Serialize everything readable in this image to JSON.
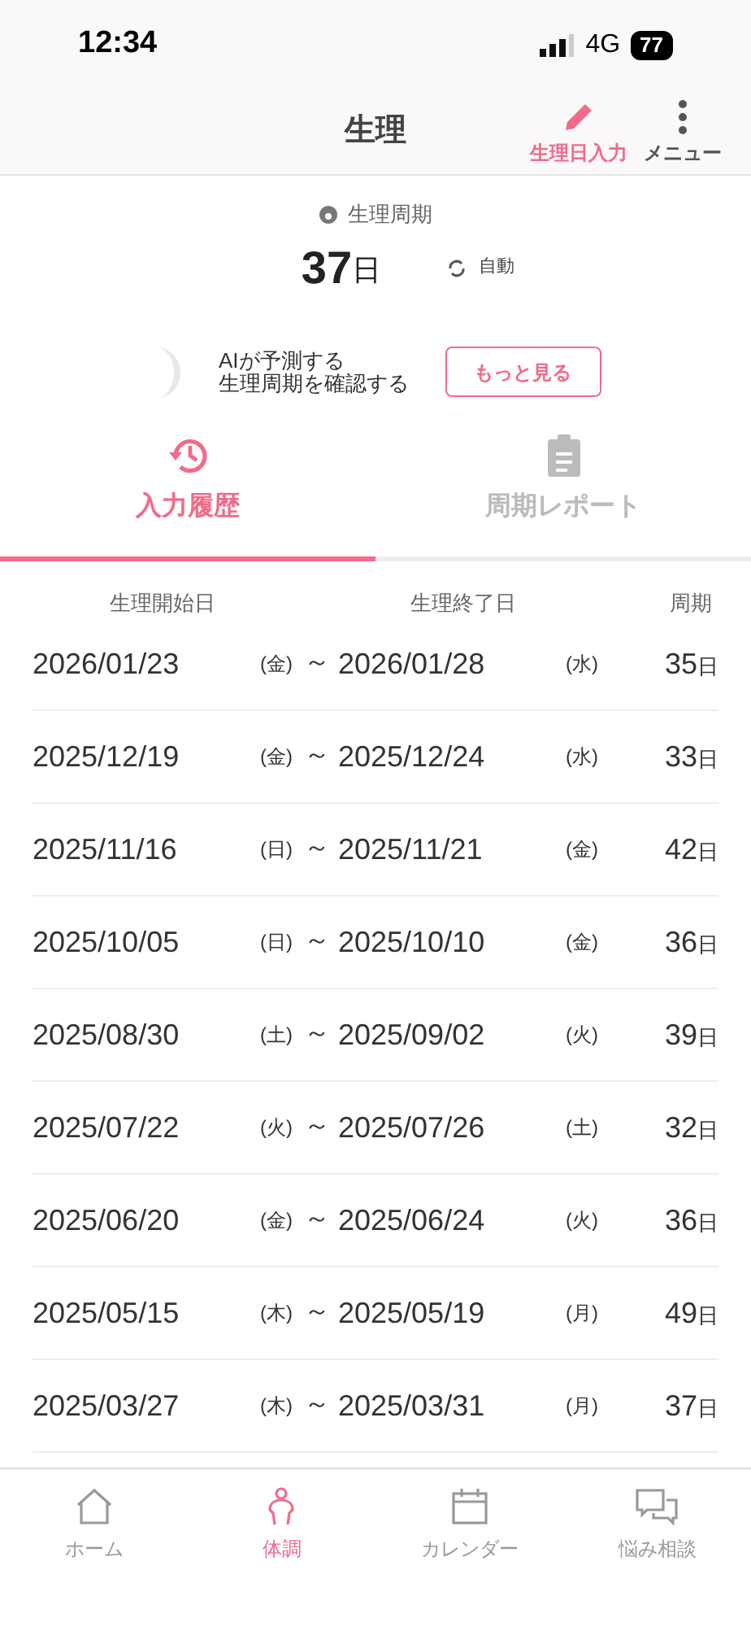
{
  "status_bar": {
    "time": "12:34",
    "network": "4G",
    "battery": "77"
  },
  "header": {
    "title": "生理",
    "actions": [
      {
        "kind": "pencil",
        "label": "生理日入力"
      },
      {
        "kind": "dots",
        "label": "メニュー"
      }
    ]
  },
  "summary": {
    "label": "生理周期",
    "value": "37",
    "unit": "日",
    "mode": "自動"
  },
  "ai_banner": {
    "lines": [
      "AIが予測する",
      "生理周期を確認する"
    ],
    "button": "もっと見る"
  },
  "tabs": [
    {
      "kind": "history",
      "label": "入力履歴",
      "selected": true
    },
    {
      "kind": "report",
      "label": "周期レポート",
      "selected": false
    }
  ],
  "table": {
    "columns": [
      "生理開始日",
      "生理終了日",
      "周期"
    ],
    "rows": [
      {
        "start": "2026/01/23",
        "start_day": "(金)",
        "sep": "～",
        "end": "2026/01/28",
        "end_day": "(水)",
        "days": "35",
        "unit": "日"
      },
      {
        "start": "2025/12/19",
        "start_day": "(金)",
        "sep": "～",
        "end": "2025/12/24",
        "end_day": "(水)",
        "days": "33",
        "unit": "日"
      },
      {
        "start": "2025/11/16",
        "start_day": "(日)",
        "sep": "～",
        "end": "2025/11/21",
        "end_day": "(金)",
        "days": "42",
        "unit": "日"
      },
      {
        "start": "2025/10/05",
        "start_day": "(日)",
        "sep": "～",
        "end": "2025/10/10",
        "end_day": "(金)",
        "days": "36",
        "unit": "日"
      },
      {
        "start": "2025/08/30",
        "start_day": "(土)",
        "sep": "～",
        "end": "2025/09/02",
        "end_day": "(火)",
        "days": "39",
        "unit": "日"
      },
      {
        "start": "2025/07/22",
        "start_day": "(火)",
        "sep": "～",
        "end": "2025/07/26",
        "end_day": "(土)",
        "days": "32",
        "unit": "日"
      },
      {
        "start": "2025/06/20",
        "start_day": "(金)",
        "sep": "～",
        "end": "2025/06/24",
        "end_day": "(火)",
        "days": "36",
        "unit": "日"
      },
      {
        "start": "2025/05/15",
        "start_day": "(木)",
        "sep": "～",
        "end": "2025/05/19",
        "end_day": "(月)",
        "days": "49",
        "unit": "日"
      },
      {
        "start": "2025/03/27",
        "start_day": "(木)",
        "sep": "～",
        "end": "2025/03/31",
        "end_day": "(月)",
        "days": "37",
        "unit": "日"
      }
    ]
  },
  "bottom_nav": [
    {
      "kind": "home",
      "label": "ホーム",
      "selected": false
    },
    {
      "kind": "body",
      "label": "体調",
      "selected": true
    },
    {
      "kind": "calendar",
      "label": "カレンダー",
      "selected": false
    },
    {
      "kind": "chat",
      "label": "悩み相談",
      "selected": false
    }
  ]
}
